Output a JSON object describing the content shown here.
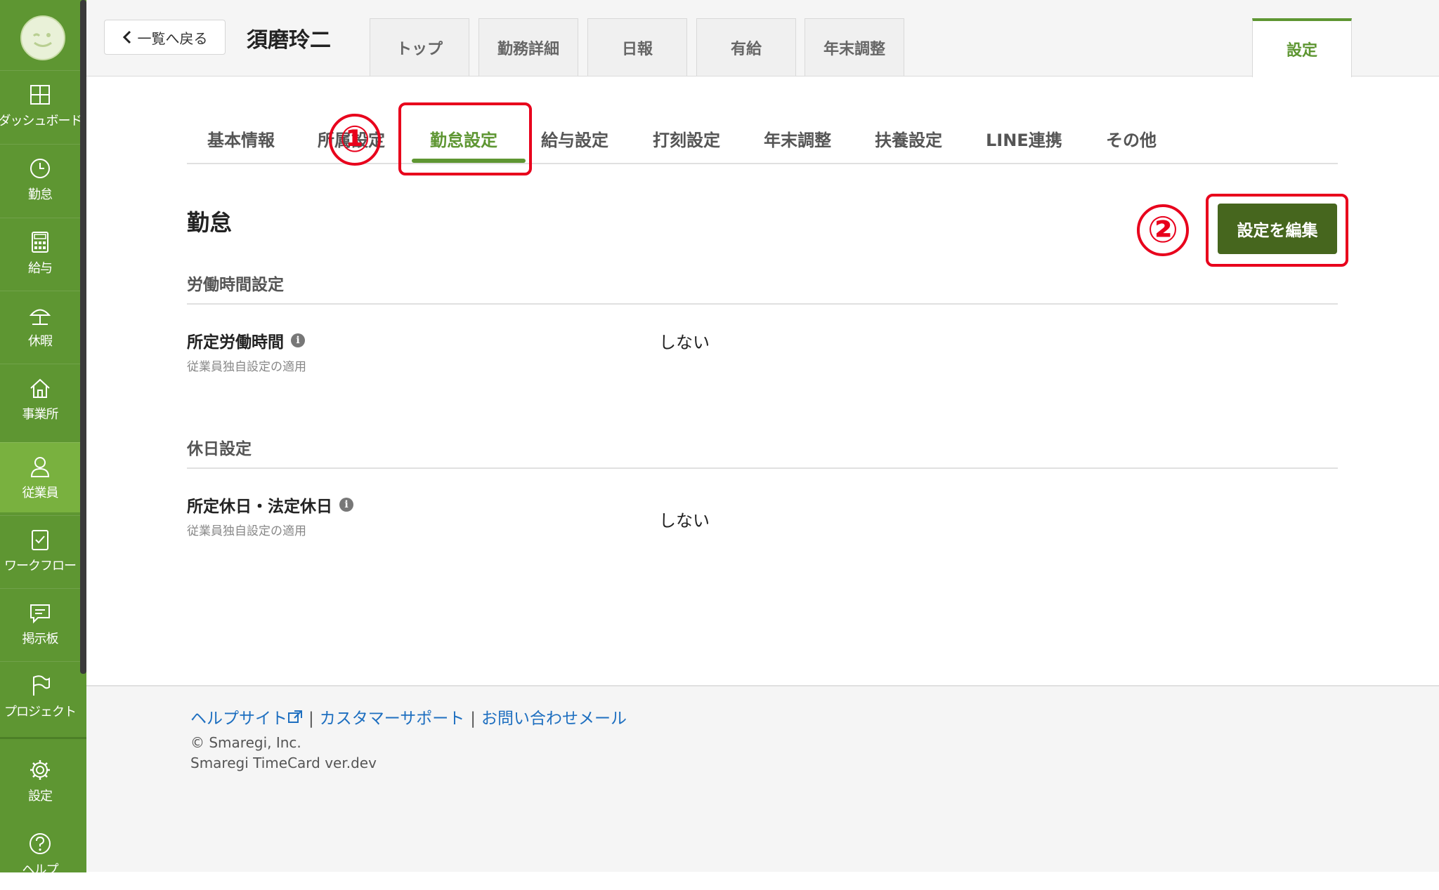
{
  "sidebar": {
    "items": [
      {
        "label": "ダッシュボード",
        "icon": "dashboard-icon"
      },
      {
        "label": "勤怠",
        "icon": "clock-icon"
      },
      {
        "label": "給与",
        "icon": "calculator-icon"
      },
      {
        "label": "休暇",
        "icon": "umbrella-icon"
      },
      {
        "label": "事業所",
        "icon": "home-icon"
      },
      {
        "label": "従業員",
        "icon": "person-icon"
      },
      {
        "label": "ワークフロー",
        "icon": "clipboard-check-icon"
      },
      {
        "label": "掲示板",
        "icon": "message-icon"
      },
      {
        "label": "プロジェクト",
        "icon": "flag-icon"
      }
    ],
    "bottom": [
      {
        "label": "設定",
        "icon": "gear-icon"
      },
      {
        "label": "ヘルプ",
        "icon": "help-icon"
      }
    ],
    "active_index": 5
  },
  "header": {
    "back_label": "一覧へ戻る",
    "employee_name": "須磨玲二",
    "tabs": [
      {
        "label": "トップ"
      },
      {
        "label": "勤務詳細"
      },
      {
        "label": "日報"
      },
      {
        "label": "有給"
      },
      {
        "label": "年末調整"
      }
    ],
    "settings_tab": "設定"
  },
  "subtabs": [
    {
      "label": "基本情報"
    },
    {
      "label": "所属設定"
    },
    {
      "label": "勤怠設定"
    },
    {
      "label": "給与設定"
    },
    {
      "label": "打刻設定"
    },
    {
      "label": "年末調整"
    },
    {
      "label": "扶養設定"
    },
    {
      "label": "LINE連携"
    },
    {
      "label": "その他"
    }
  ],
  "annotations": {
    "one": "①",
    "two": "②",
    "color": "#e8001c"
  },
  "main": {
    "title": "勤怠",
    "edit_button": "設定を編集",
    "groups": [
      {
        "heading": "労働時間設定",
        "field_label": "所定労働時間",
        "field_sub": "従業員独自設定の適用",
        "value": "しない"
      },
      {
        "heading": "休日設定",
        "field_label": "所定休日・法定休日",
        "field_sub": "従業員独自設定の適用",
        "value": "しない"
      }
    ]
  },
  "footer": {
    "help_site": "ヘルプサイト",
    "customer_support": "カスタマーサポート",
    "contact_mail": "お問い合わせメール",
    "separator": "|",
    "copyright": "© Smaregi, Inc.",
    "version": "Smaregi TimeCard ver.dev"
  },
  "colors": {
    "brand": "#5e9632",
    "active_nav": "#79b13f",
    "link": "#1e6fc0"
  }
}
